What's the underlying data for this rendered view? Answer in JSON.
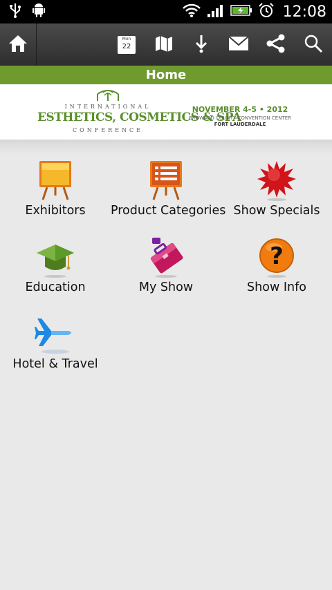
{
  "status_bar": {
    "time": "12:08"
  },
  "toolbar": {
    "calendar": {
      "day": "Mon",
      "date": "22"
    },
    "icons": [
      "home-icon",
      "calendar-icon",
      "map-icon",
      "download-icon",
      "mail-icon",
      "share-icon",
      "search-icon"
    ]
  },
  "header": {
    "title": "Home"
  },
  "banner": {
    "logo_top": "INTERNATIONAL",
    "logo_main": "ESTHETICS, COSMETICS & SPA",
    "logo_bottom": "CONFERENCE",
    "dates": "NOVEMBER 4-5 • 2012",
    "venue": "BROWARD COUNTY CONVENTION CENTER",
    "city": "FORT LAUDERDALE"
  },
  "menu": [
    {
      "label": "Exhibitors",
      "icon": "easel-yellow-icon"
    },
    {
      "label": "Product Categories",
      "icon": "easel-list-icon"
    },
    {
      "label": "Show Specials",
      "icon": "starburst-icon"
    },
    {
      "label": "Education",
      "icon": "graduation-cap-icon"
    },
    {
      "label": "My Show",
      "icon": "briefcase-icon"
    },
    {
      "label": "Show Info",
      "icon": "question-icon"
    },
    {
      "label": "Hotel & Travel",
      "icon": "airplane-icon"
    }
  ],
  "colors": {
    "accent_green": "#6f9a2e",
    "toolbar": "#3a3a3a",
    "background": "#e9e9e9"
  }
}
